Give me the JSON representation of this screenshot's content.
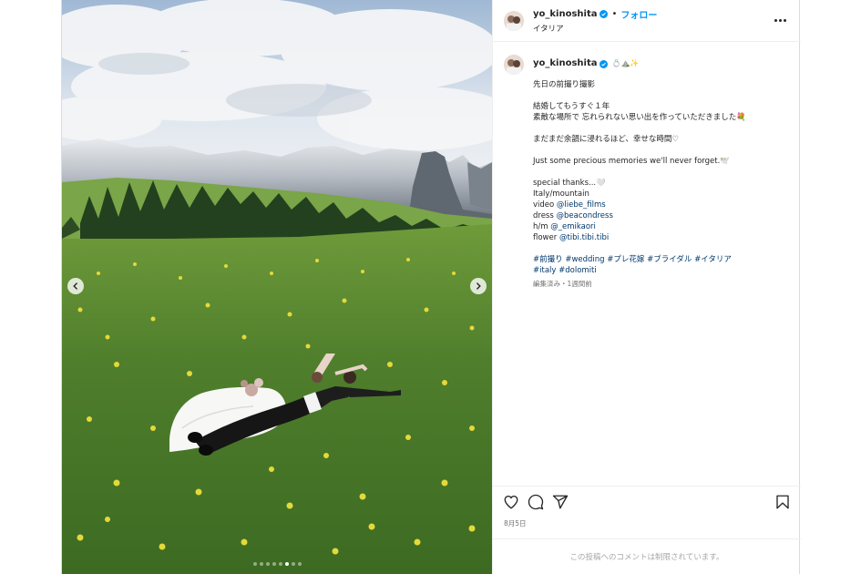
{
  "post": {
    "username": "yo_kinoshita",
    "follow_label": "フォロー",
    "separator": "•",
    "location": "イタリア",
    "caption": {
      "header_emoji": "💍⛰️✨",
      "lines": [
        "先日の前撮り撮影",
        "",
        "結婚してもうすぐ１年",
        "素敵な場所で 忘れられない思い出を作っていただきました💐",
        "",
        "まだまだ余韻に浸れるほど、幸せな時間♡",
        "",
        "Just some precious memories we'll never forget.🕊️",
        "",
        "special thanks...🤍",
        "Italy/mountain"
      ],
      "credits": [
        {
          "label": "video ",
          "handle": "@liebe_films"
        },
        {
          "label": "dress ",
          "handle": "@beacondress"
        },
        {
          "label": "h/m ",
          "handle": "@_emikaori"
        },
        {
          "label": "flower ",
          "handle": "@tibi.tibi.tibi"
        }
      ],
      "hashtags_line1": "#前撮り #wedding #プレ花嫁 #ブライダル #イタリア",
      "hashtags_line2": "#italy #dolomiti",
      "meta": "編集済み・1週間前"
    },
    "date": "8月5日",
    "comments_off": "この投稿へのコメントは制限されています。",
    "carousel": {
      "count": 8,
      "active_index": 5
    }
  },
  "icons": {
    "more": "more-horizontal-icon",
    "verified": "verified-badge-icon",
    "like": "heart-icon",
    "comment": "comment-icon",
    "share": "share-icon",
    "save": "bookmark-icon",
    "prev": "chevron-left-icon",
    "next": "chevron-right-icon"
  },
  "colors": {
    "accent": "#0095f6",
    "link": "#00376b",
    "muted": "#737373",
    "border": "#dbdbdb"
  }
}
